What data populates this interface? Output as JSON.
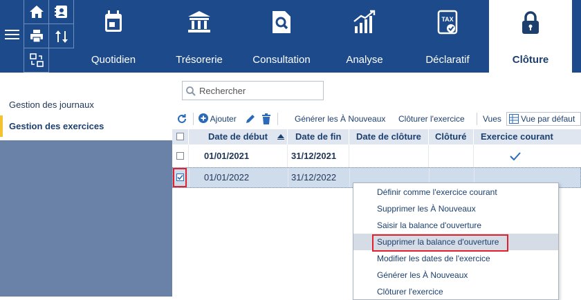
{
  "ribbon": {
    "tabs": [
      {
        "label": "Quotidien",
        "icon": "calendar-icon"
      },
      {
        "label": "Trésorerie",
        "icon": "bank-icon"
      },
      {
        "label": "Consultation",
        "icon": "document-search-icon"
      },
      {
        "label": "Analyse",
        "icon": "bar-chart-icon"
      },
      {
        "label": "Déclaratif",
        "icon": "tax-document-icon",
        "icon_text": "TAX"
      },
      {
        "label": "Clôture",
        "icon": "lock-icon"
      }
    ],
    "active_tab": "Clôture",
    "quick_icons": [
      "home-icon",
      "contacts-icon",
      "print-icon",
      "transfer-icon",
      "sort-icon"
    ]
  },
  "sidebar": {
    "items": [
      {
        "label": "Gestion des journaux",
        "selected": false
      },
      {
        "label": "Gestion des exercices",
        "selected": true
      }
    ]
  },
  "search": {
    "placeholder": "Rechercher"
  },
  "toolbar": {
    "add_label": "Ajouter",
    "generate_label": "Générer les À Nouveaux",
    "close_label": "Clôturer l'exercice",
    "views_label": "Vues",
    "views_value": "Vue par défaut"
  },
  "table": {
    "columns": [
      "Date de début",
      "Date de fin",
      "Date de clôture",
      "Clôturé",
      "Exercice courant"
    ],
    "rows": [
      {
        "debut": "01/01/2021",
        "fin": "31/12/2021",
        "cloture": "",
        "cloture_flag": "",
        "courant": true,
        "checked": false
      },
      {
        "debut": "01/01/2022",
        "fin": "31/12/2022",
        "cloture": "",
        "cloture_flag": "",
        "courant": false,
        "checked": true
      }
    ]
  },
  "context_menu": {
    "items": [
      "Définir comme l'exercice courant",
      "Supprimer les À Nouveaux",
      "Saisir la balance d'ouverture",
      "Supprimer la balance d'ouverture",
      "Modifier les dates de l'exercice",
      "Générer les À Nouveaux",
      "Clôturer l'exercice"
    ],
    "highlighted": "Supprimer la balance d'ouverture"
  },
  "colors": {
    "ribbon": "#1c4a8b",
    "sidebar": "#6b82a8",
    "selection_marker": "#f2c230",
    "annotation": "#e0202a"
  }
}
